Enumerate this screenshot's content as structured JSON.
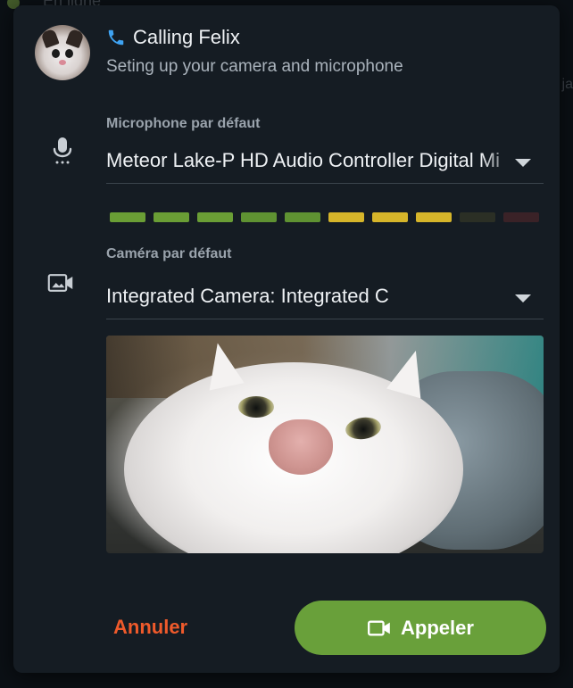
{
  "background": {
    "status_text": "En ligne",
    "edge_text": "ja"
  },
  "dialog": {
    "title": "Calling Felix",
    "subtitle": "Seting up your camera and microphone",
    "avatar_name": "Felix",
    "microphone": {
      "label": "Microphone par défaut",
      "value": "Meteor Lake-P HD Audio Controller Digital Mi",
      "icon": "microphone-icon"
    },
    "audio_meter": {
      "segments": [
        "#6a9e35",
        "#6a9e35",
        "#6a9e35",
        "#5f9232",
        "#5f9232",
        "#d6b52a",
        "#d6b52a",
        "#d6b52a",
        "#2b2f25",
        "#3a2227"
      ],
      "active_segments": 8,
      "total_segments": 10
    },
    "camera": {
      "label": "Caméra par défaut",
      "value": "Integrated Camera: Integrated C",
      "icon": "video-camera-icon"
    },
    "buttons": {
      "cancel": "Annuler",
      "call": "Appeler"
    },
    "colors": {
      "accent_green": "#69a03a",
      "cancel_red": "#ef5a2b",
      "phone_blue": "#3fa3f2",
      "dialog_bg": "#151c23"
    }
  }
}
